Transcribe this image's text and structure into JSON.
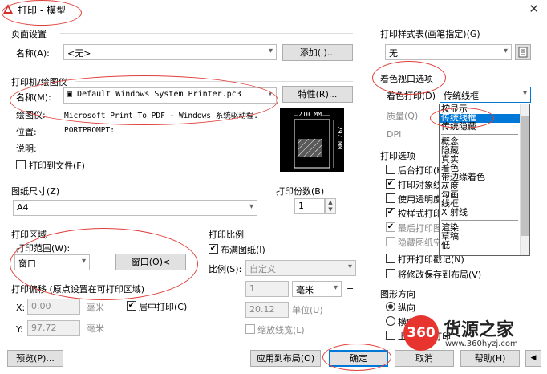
{
  "window": {
    "title": "打印 - 模型",
    "close": "✕"
  },
  "page_setup": {
    "group": "页面设置",
    "name_label": "名称(A):",
    "name_value": "<无>",
    "add_button": "添加(.)..."
  },
  "printer": {
    "group": "打印机/绘图仪",
    "name_label": "名称(M):",
    "name_value": "Default Windows System Printer.pc3",
    "props_button": "特性(R)...",
    "plotter_label": "绘图仪:",
    "plotter_value": "Microsoft Print To PDF - Windows 系统驱动程.",
    "location_label": "位置:",
    "location_value": "PORTPROMPT:",
    "desc_label": "说明:",
    "to_file": "打印到文件(F)",
    "preview_width": "210 MM",
    "preview_height": "297 MM"
  },
  "paper_size": {
    "group": "图纸尺寸(Z)",
    "value": "A4"
  },
  "copies": {
    "group": "打印份数(B)",
    "value": "1"
  },
  "plot_area": {
    "group": "打印区域",
    "range_label": "打印范围(W):",
    "range_value": "窗口",
    "window_button": "窗口(O)<"
  },
  "offset": {
    "group": "打印偏移 (原点设置在可打印区域)",
    "x_label": "X:",
    "x_value": "0.00",
    "x_unit": "毫米",
    "y_label": "Y:",
    "y_value": "97.72",
    "y_unit": "毫米",
    "center": "居中打印(C)"
  },
  "scale": {
    "group": "打印比例",
    "fit": "布满图纸(I)",
    "ratio_label": "比例(S):",
    "ratio_value": "自定义",
    "v1": "1",
    "unit1": "毫米",
    "eq": "=",
    "v2": "20.12",
    "unit2": "单位(U)",
    "lineweights": "缩放线宽(L)"
  },
  "plot_style": {
    "group": "打印样式表(画笔指定)(G)",
    "value": "无"
  },
  "viewport": {
    "group": "着色视口选项",
    "shade_label": "着色打印(D)",
    "shade_value": "传统线框",
    "quality_label": "质量(Q)",
    "dpi_label": "DPI",
    "dropdown_items": [
      "按显示",
      "传统线框",
      "传统隐藏",
      "",
      "概念",
      "隐藏",
      "真实",
      "着色",
      "带边缘着色",
      "灰度",
      "勾画",
      "线框",
      "X 射线",
      "",
      "渲染",
      "草稿",
      "低"
    ]
  },
  "options": {
    "group": "打印选项",
    "items": [
      "后台打印(K)",
      "打印对象线宽",
      "使用透明度",
      "按样式打印",
      "最后打印图",
      "隐藏图纸空",
      "打开打印戳记(N)",
      "将修改保存到布局(V)"
    ]
  },
  "orientation": {
    "group": "图形方向",
    "portrait": "纵向",
    "landscape": "横向",
    "upside": "上下颠倒打印"
  },
  "footer": {
    "preview": "预览(P)...",
    "apply": "应用到布局(O)",
    "ok": "确定",
    "cancel": "取消",
    "help": "帮助(H)"
  },
  "watermark": {
    "logo": "360",
    "brand": "货源之家",
    "url": "www.360hyzj.com"
  }
}
